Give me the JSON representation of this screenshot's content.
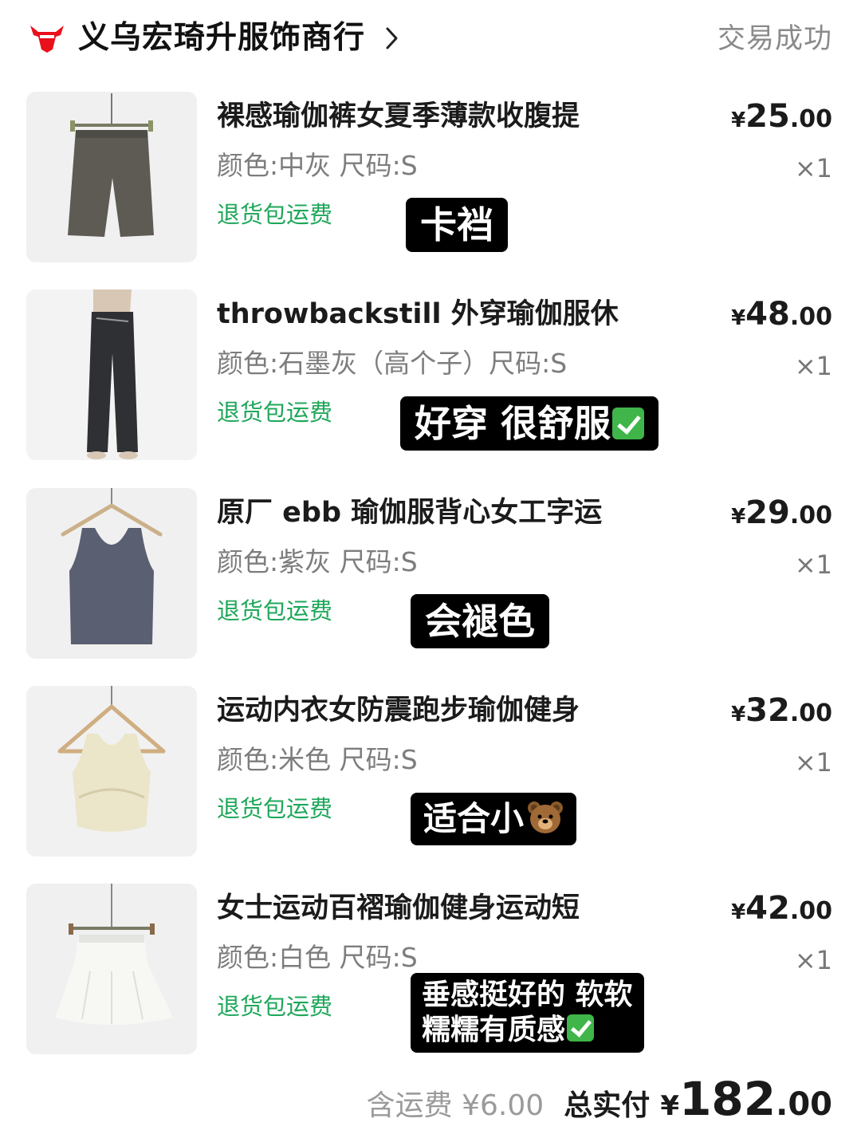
{
  "header": {
    "shop_name": "义乌宏琦升服饰商行",
    "status": "交易成功"
  },
  "colors": {
    "brand_red": "#e8101a",
    "return_green": "#1fa75a",
    "note_bg": "#000000"
  },
  "items": [
    {
      "title": "裸感瑜伽裤女夏季薄款收腹提",
      "spec": "颜色:中灰 尺码:S",
      "return_tag": "退货包运费",
      "price_symbol": "¥",
      "price_int": "25",
      "price_dec": ".00",
      "qty": "×1",
      "note": "卡裆",
      "thumb_icon": "gray-shorts-icon"
    },
    {
      "title": "throwbackstill 外穿瑜伽服休",
      "spec": "颜色:石墨灰（高个子）尺码:S",
      "return_tag": "退货包运费",
      "price_symbol": "¥",
      "price_int": "48",
      "price_dec": ".00",
      "qty": "×1",
      "note": "好穿 很舒服",
      "thumb_icon": "black-pants-icon"
    },
    {
      "title": "原厂 ebb 瑜伽服背心女工字运",
      "spec": "颜色:紫灰 尺码:S",
      "return_tag": "退货包运费",
      "price_symbol": "¥",
      "price_int": "29",
      "price_dec": ".00",
      "qty": "×1",
      "note": "会褪色",
      "thumb_icon": "tank-top-icon"
    },
    {
      "title": "运动内衣女防震跑步瑜伽健身",
      "spec": "颜色:米色 尺码:S",
      "return_tag": "退货包运费",
      "price_symbol": "¥",
      "price_int": "32",
      "price_dec": ".00",
      "qty": "×1",
      "note": "适合小",
      "thumb_icon": "sports-bra-icon"
    },
    {
      "title": "女士运动百褶瑜伽健身运动短",
      "spec": "颜色:白色 尺码:S",
      "return_tag": "退货包运费",
      "price_symbol": "¥",
      "price_int": "42",
      "price_dec": ".00",
      "qty": "×1",
      "note_line1": "垂感挺好的 软软",
      "note_line2": "糯糯有质感",
      "thumb_icon": "white-skirt-icon"
    }
  ],
  "footer": {
    "shipping": "含运费 ¥6.00",
    "total_label": "总实付",
    "total_symbol": "¥",
    "total_int": "182",
    "total_dec": ".00"
  }
}
